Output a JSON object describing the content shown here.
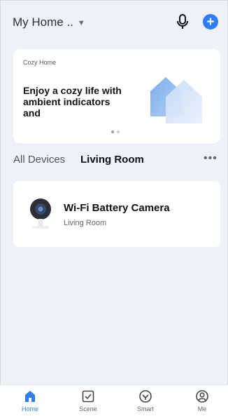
{
  "header": {
    "home_title": "My Home ..",
    "caret_icon": "caret-down-icon",
    "mic_icon": "microphone-icon",
    "add_icon": "plus-icon",
    "accent": "#2e7bf6"
  },
  "banner": {
    "subtitle": "Cozy Home",
    "headline": "Enjoy a cozy life with ambient indicators and",
    "page_count": 2,
    "active_page": 1
  },
  "tabs": {
    "items": [
      "All Devices",
      "Living Room"
    ],
    "selected": "Living Room",
    "more_icon": "more-horizontal-icon",
    "more_glyph": "•••"
  },
  "device": {
    "name": "Wi-Fi Battery Camera",
    "room": "Living Room",
    "icon": "camera-icon"
  },
  "bottom_nav": {
    "items": [
      {
        "label": "Home",
        "icon": "home-icon",
        "active": true
      },
      {
        "label": "Scene",
        "icon": "scene-icon",
        "active": false
      },
      {
        "label": "Smart",
        "icon": "smart-icon",
        "active": false
      },
      {
        "label": "Me",
        "icon": "profile-icon",
        "active": false
      }
    ]
  }
}
